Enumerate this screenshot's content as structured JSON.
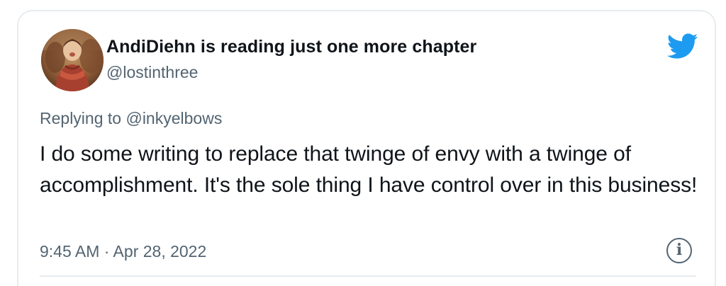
{
  "author": {
    "display_name": "AndiDiehn is reading just one more chapter",
    "handle": "@lostinthree",
    "avatar_icon": "profile-photo"
  },
  "brand": {
    "icon": "twitter-bird-icon",
    "color": "#1d9bf0"
  },
  "reply": {
    "prefix": "Replying to",
    "mention": "@inkyelbows"
  },
  "tweet": {
    "text": "I do some writing to replace that twinge of envy with a twinge of accomplishment. It's the sole thing I have control over in this business!",
    "timestamp": "9:45 AM · Apr 28, 2022"
  },
  "actions": {
    "info_icon": "info-icon",
    "info_glyph": "i"
  },
  "colors": {
    "text_primary": "#0f1419",
    "text_secondary": "#536471",
    "border": "#e6ecf0"
  }
}
